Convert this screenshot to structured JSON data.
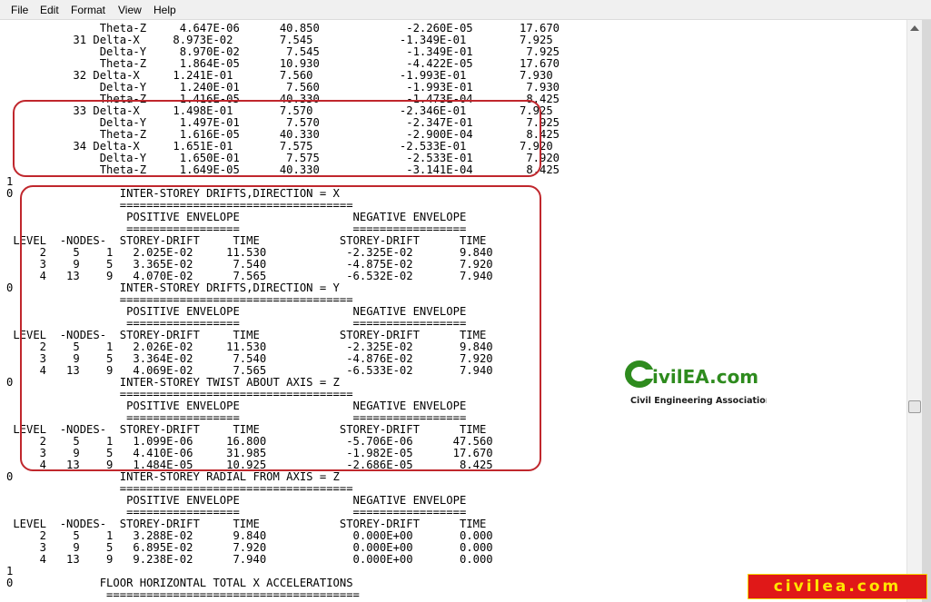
{
  "menu": [
    "File",
    "Edit",
    "Format",
    "View",
    "Help"
  ],
  "lines": [
    "              Theta-Z     4.647E-06      40.850             -2.260E-05       17.670",
    "          31 Delta-X     8.973E-02       7.545             -1.349E-01        7.925",
    "              Delta-Y     8.970E-02       7.545             -1.349E-01        7.925",
    "              Theta-Z     1.864E-05      10.930             -4.422E-05       17.670",
    "          32 Delta-X     1.241E-01       7.560             -1.993E-01        7.930",
    "              Delta-Y     1.240E-01       7.560             -1.993E-01        7.930",
    "              Theta-Z     1.416E-05      40.330             -1.473E-04        8.425",
    "          33 Delta-X     1.498E-01       7.570             -2.346E-01        7.925",
    "              Delta-Y     1.497E-01       7.570             -2.347E-01        7.925",
    "              Theta-Z     1.616E-05      40.330             -2.900E-04        8.425",
    "          34 Delta-X     1.651E-01       7.575             -2.533E-01        7.920",
    "              Delta-Y     1.650E-01       7.575             -2.533E-01        7.920",
    "              Theta-Z     1.649E-05      40.330             -3.141E-04        8.425",
    "1",
    "0                INTER-STOREY DRIFTS,DIRECTION = X",
    "                 ===================================",
    "                  POSITIVE ENVELOPE                 NEGATIVE ENVELOPE",
    "                  =================                 =================",
    " LEVEL  -NODES-  STOREY-DRIFT     TIME            STOREY-DRIFT      TIME",
    "     2    5    1   2.025E-02     11.530            -2.325E-02       9.840",
    "     3    9    5   3.365E-02      7.540            -4.875E-02       7.920",
    "     4   13    9   4.070E-02      7.565            -6.532E-02       7.940",
    "0                INTER-STOREY DRIFTS,DIRECTION = Y",
    "                 ===================================",
    "                  POSITIVE ENVELOPE                 NEGATIVE ENVELOPE",
    "                  =================                 =================",
    " LEVEL  -NODES-  STOREY-DRIFT     TIME            STOREY-DRIFT      TIME",
    "     2    5    1   2.026E-02     11.530            -2.325E-02       9.840",
    "     3    9    5   3.364E-02      7.540            -4.876E-02       7.920",
    "     4   13    9   4.069E-02      7.565            -6.533E-02       7.940",
    "0                INTER-STOREY TWIST ABOUT AXIS = Z",
    "                 ===================================",
    "                  POSITIVE ENVELOPE                 NEGATIVE ENVELOPE",
    "                  =================                 =================",
    " LEVEL  -NODES-  STOREY-DRIFT     TIME            STOREY-DRIFT      TIME",
    "     2    5    1   1.099E-06     16.800            -5.706E-06      47.560",
    "     3    9    5   4.410E-06     31.985            -1.982E-05      17.670",
    "     4   13    9   1.484E-05     10.925            -2.686E-05       8.425",
    "0                INTER-STOREY RADIAL FROM AXIS = Z",
    "                 ===================================",
    "                  POSITIVE ENVELOPE                 NEGATIVE ENVELOPE",
    "                  =================                 =================",
    " LEVEL  -NODES-  STOREY-DRIFT     TIME            STOREY-DRIFT      TIME",
    "     2    5    1   3.288E-02      9.840             0.000E+00       0.000",
    "     3    9    5   6.895E-02      7.920             0.000E+00       0.000",
    "     4   13    9   9.238E-02      7.940             0.000E+00       0.000",
    "1",
    "0             FLOOR HORIZONTAL TOTAL X ACCELERATIONS",
    "               ======================================"
  ],
  "logo": {
    "name": "CivilEA.com",
    "tagline": "Civil Engineering Association"
  },
  "watermark": "civilea.com",
  "colors": {
    "highlight": "#c0272d",
    "logo_green": "#2e8b1e",
    "watermark_bg": "#e01818",
    "watermark_text": "#ffe600"
  }
}
